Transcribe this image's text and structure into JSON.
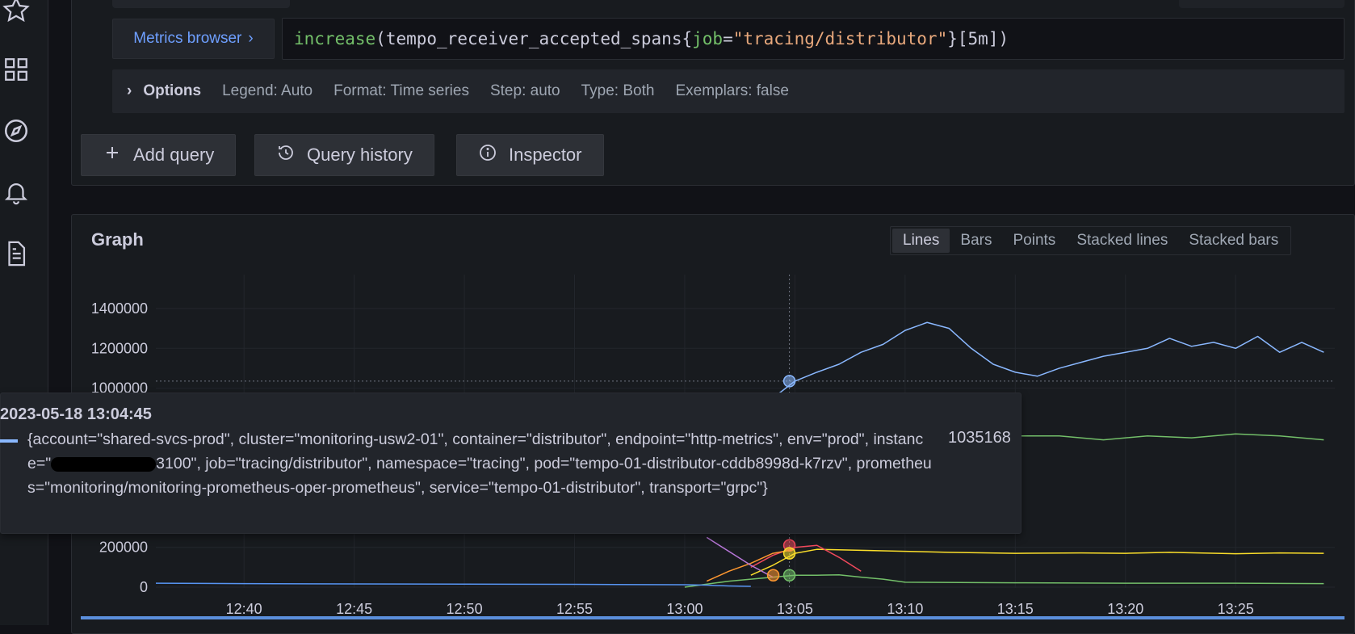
{
  "query": {
    "metrics_browser_label": "Metrics browser",
    "expr": {
      "fn": "increase",
      "open": "(",
      "metric": "tempo_receiver_accepted_spans",
      "brace_open": "{",
      "label_key": "job",
      "eq": "=",
      "label_value": "\"tracing/distributor\"",
      "brace_close": "}",
      "range": "[5m])"
    },
    "options": {
      "title": "Options",
      "items": [
        "Legend: Auto",
        "Format: Time series",
        "Step: auto",
        "Type: Both",
        "Exemplars: false"
      ]
    }
  },
  "actions": {
    "add_query": "Add query",
    "query_history": "Query history",
    "inspector": "Inspector"
  },
  "graph": {
    "title": "Graph",
    "types": [
      "Lines",
      "Bars",
      "Points",
      "Stacked lines",
      "Stacked bars"
    ],
    "active_type": "Lines"
  },
  "chart_data": {
    "type": "line",
    "y_ticks": [
      "1400000",
      "1200000",
      "1000000",
      "200000",
      "0"
    ],
    "x_ticks": [
      "12:40",
      "12:45",
      "12:50",
      "12:55",
      "13:00",
      "13:05",
      "13:10",
      "13:15",
      "13:20",
      "13:25"
    ],
    "ylim": [
      0,
      1400000
    ],
    "grid": true,
    "hover_time": "13:04:45",
    "colors": {
      "blue": "#8ab8ff",
      "green": "#73bf69",
      "yellow": "#fade2a",
      "orange": "#ff9830",
      "red": "#f2495c",
      "purple": "#b877d9",
      "dark_blue": "#5794f2"
    },
    "series": [
      {
        "color": "blue",
        "x": [
          "13:04",
          "13:05",
          "13:06",
          "13:07",
          "13:08",
          "13:09",
          "13:10",
          "13:11",
          "13:12",
          "13:13",
          "13:14",
          "13:15",
          "13:16",
          "13:17",
          "13:18",
          "13:19",
          "13:20",
          "13:21",
          "13:22",
          "13:23",
          "13:24",
          "13:25",
          "13:26",
          "13:27",
          "13:28",
          "13:29"
        ],
        "values": [
          950000,
          1035168,
          1080000,
          1120000,
          1180000,
          1220000,
          1290000,
          1330000,
          1300000,
          1200000,
          1120000,
          1080000,
          1060000,
          1100000,
          1130000,
          1160000,
          1180000,
          1200000,
          1250000,
          1210000,
          1230000,
          1200000,
          1260000,
          1180000,
          1230000,
          1180000
        ]
      },
      {
        "color": "green",
        "x": [
          "13:13",
          "13:15",
          "13:17",
          "13:19",
          "13:21",
          "13:23",
          "13:25",
          "13:27",
          "13:29"
        ],
        "values": [
          720000,
          760000,
          760000,
          740000,
          760000,
          750000,
          770000,
          760000,
          740000
        ]
      },
      {
        "color": "yellow",
        "x": [
          "13:03",
          "13:04",
          "13:05",
          "13:06",
          "13:08",
          "13:10",
          "13:12",
          "13:15",
          "13:18",
          "13:20",
          "13:22",
          "13:25",
          "13:27",
          "13:29"
        ],
        "values": [
          60000,
          110000,
          170000,
          190000,
          185000,
          180000,
          175000,
          170000,
          172000,
          170000,
          175000,
          168000,
          172000,
          170000
        ]
      },
      {
        "color": "green",
        "x": [
          "13:00",
          "13:02",
          "13:04",
          "13:05",
          "13:06",
          "13:07",
          "13:08",
          "13:09",
          "13:10",
          "13:15",
          "13:20",
          "13:25",
          "13:29"
        ],
        "values": [
          0,
          30000,
          50000,
          60000,
          60000,
          62000,
          50000,
          40000,
          25000,
          22000,
          20000,
          20000,
          18000
        ]
      },
      {
        "color": "red",
        "x": [
          "13:03",
          "13:04",
          "13:05",
          "13:06",
          "13:07",
          "13:08"
        ],
        "values": [
          100000,
          160000,
          200000,
          210000,
          150000,
          80000
        ]
      },
      {
        "color": "orange",
        "x": [
          "13:01",
          "13:02",
          "13:03",
          "13:04",
          "13:05"
        ],
        "values": [
          30000,
          80000,
          120000,
          170000,
          190000
        ]
      },
      {
        "color": "purple",
        "x": [
          "13:01",
          "13:02",
          "13:03",
          "13:04"
        ],
        "values": [
          250000,
          180000,
          110000,
          50000
        ]
      },
      {
        "color": "dark_blue",
        "x": [
          "12:36",
          "12:40",
          "12:45",
          "12:50",
          "12:55",
          "13:00",
          "13:01",
          "13:02",
          "13:03"
        ],
        "values": [
          20000,
          18000,
          16000,
          15000,
          14000,
          12000,
          10000,
          6000,
          4000
        ]
      }
    ]
  },
  "tooltip": {
    "time": "2023-05-18 13:04:45",
    "label_before": "{account=\"shared-svcs-prod\", cluster=\"monitoring-usw2-01\", container=\"distributor\", endpoint=\"http-metrics\", env=\"prod\", instance=\"",
    "label_after": "3100\", job=\"tracing/distributor\", namespace=\"tracing\", pod=\"tempo-01-distributor-cddb8998d-k7rzv\", prometheus=\"monitoring/monitoring-prometheus-oper-prometheus\", service=\"tempo-01-distributor\", transport=\"grpc\"}",
    "value": "1035168"
  }
}
